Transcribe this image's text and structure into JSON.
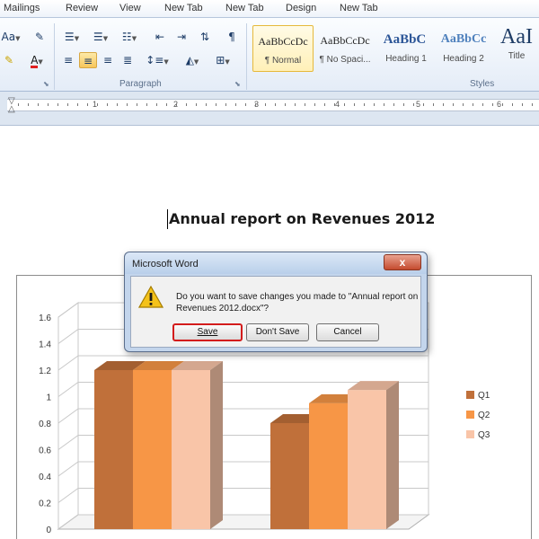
{
  "ribbon": {
    "tabs": [
      "Mailings",
      "Review",
      "View",
      "New Tab",
      "New Tab",
      "Design",
      "New Tab"
    ],
    "font_buttons": {
      "change_case": "Aa",
      "font_color": "A"
    },
    "paragraph_group_label": "Paragraph",
    "styles_group_label": "Styles",
    "styles": [
      {
        "preview": "AaBbCcDc",
        "label": "¶ Normal"
      },
      {
        "preview": "AaBbCcDc",
        "label": "¶ No Spaci..."
      },
      {
        "preview": "AaBbC ",
        "label": "Heading 1"
      },
      {
        "preview": "AaBbCc",
        "label": "Heading 2"
      },
      {
        "preview": "AaI",
        "label": "Title"
      }
    ]
  },
  "ruler": {
    "numbers": [
      "1",
      "2",
      "3",
      "4",
      "5",
      "6"
    ]
  },
  "document": {
    "title": "Annual report on Revenues 2012"
  },
  "dialog": {
    "title": "Microsoft Word",
    "close_label": "x",
    "message": "Do you want to save changes you made to \"Annual report on Revenues 2012.docx\"?",
    "buttons": {
      "save": "Save",
      "dont_save": "Don't Save",
      "cancel": "Cancel"
    }
  },
  "colors": {
    "q1": "#c0703a",
    "q2": "#f79646",
    "q3": "#f9c5a8"
  },
  "chart_data": {
    "type": "bar",
    "categories": [
      "",
      ""
    ],
    "series": [
      {
        "name": "Q1",
        "values": [
          1.2,
          0.8
        ]
      },
      {
        "name": "Q2",
        "values": [
          1.2,
          0.95
        ]
      },
      {
        "name": "Q3",
        "values": [
          1.2,
          1.05
        ]
      }
    ],
    "ylim": [
      0,
      1.6
    ],
    "yticks": [
      "0",
      "0.2",
      "0.4",
      "0.6",
      "0.8",
      "1",
      "1.2",
      "1.4",
      "1.6"
    ],
    "grid": true,
    "legend": "right",
    "three_d": true
  }
}
